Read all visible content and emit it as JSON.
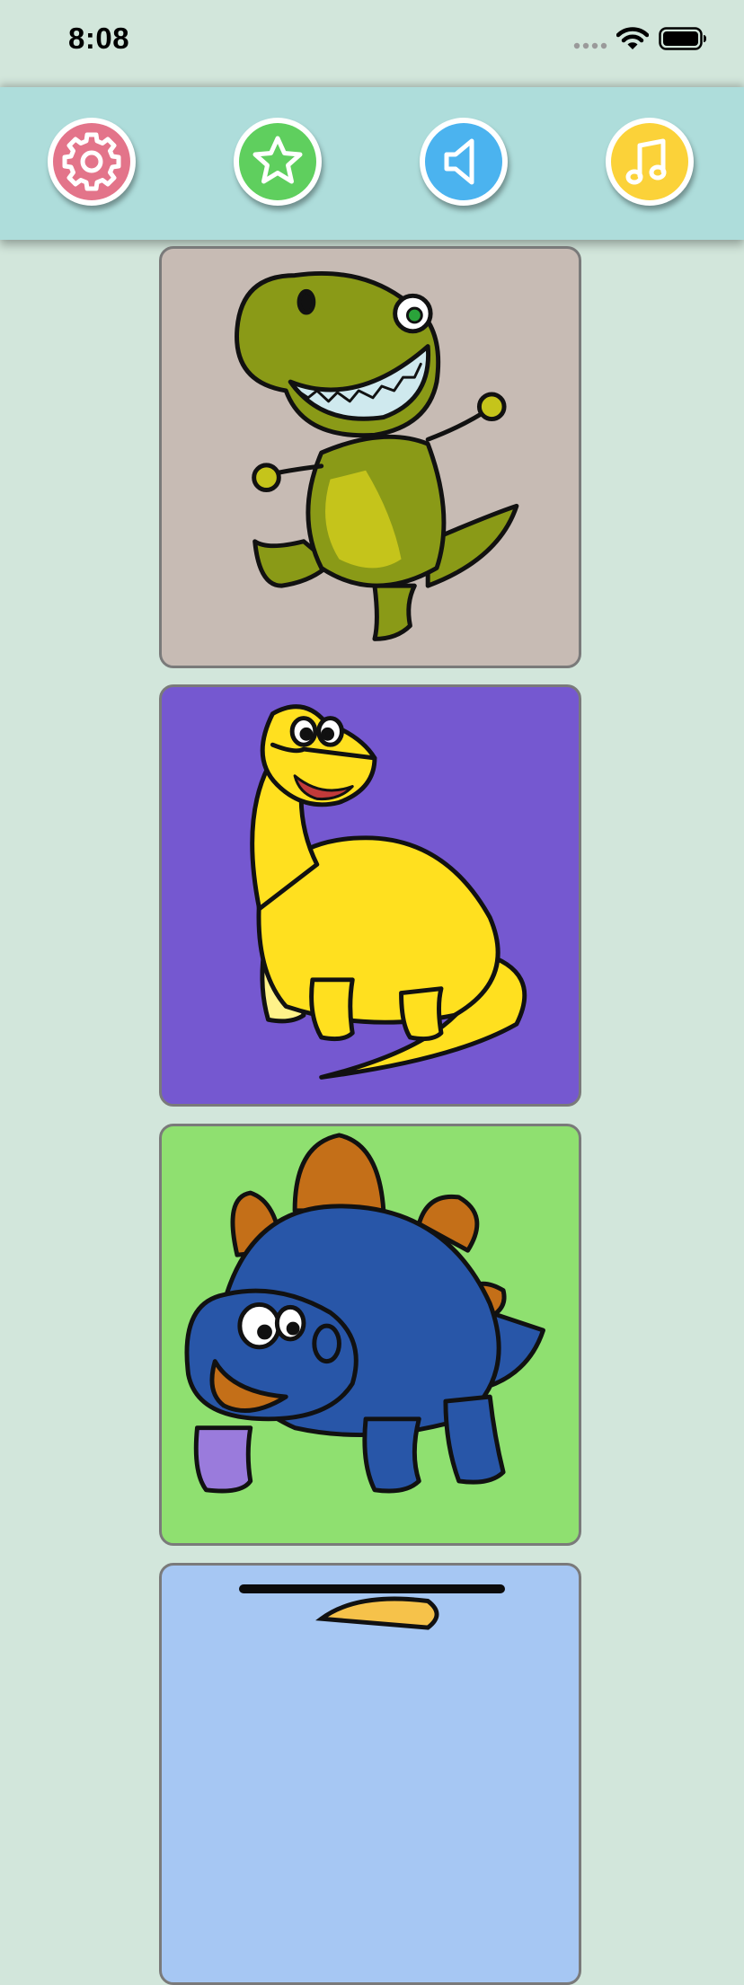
{
  "status_bar": {
    "time": "8:08"
  },
  "toolbar": {
    "buttons": [
      {
        "name": "settings",
        "icon": "gear-icon",
        "color": "#e3748a"
      },
      {
        "name": "favorites",
        "icon": "star-icon",
        "color": "#5fcf5e"
      },
      {
        "name": "sound",
        "icon": "speaker-icon",
        "color": "#4bb3ef"
      },
      {
        "name": "music",
        "icon": "music-note-icon",
        "color": "#fbd239"
      }
    ]
  },
  "gallery": {
    "cards": [
      {
        "name": "t-rex",
        "icon": "t-rex-dinosaur-picture",
        "background": "#c7bbb4",
        "body_color": "#8a9a17"
      },
      {
        "name": "brontosaurus",
        "icon": "brontosaurus-dinosaur-picture",
        "background": "#7558d0",
        "body_color": "#ffe01f"
      },
      {
        "name": "stegosaurus",
        "icon": "stegosaurus-dinosaur-picture",
        "background": "#8fe070",
        "body_color": "#2856a8"
      },
      {
        "name": "partial-next",
        "icon": "dinosaur-picture",
        "background": "#a6c7f3",
        "body_color": "#f6c24a"
      }
    ]
  }
}
